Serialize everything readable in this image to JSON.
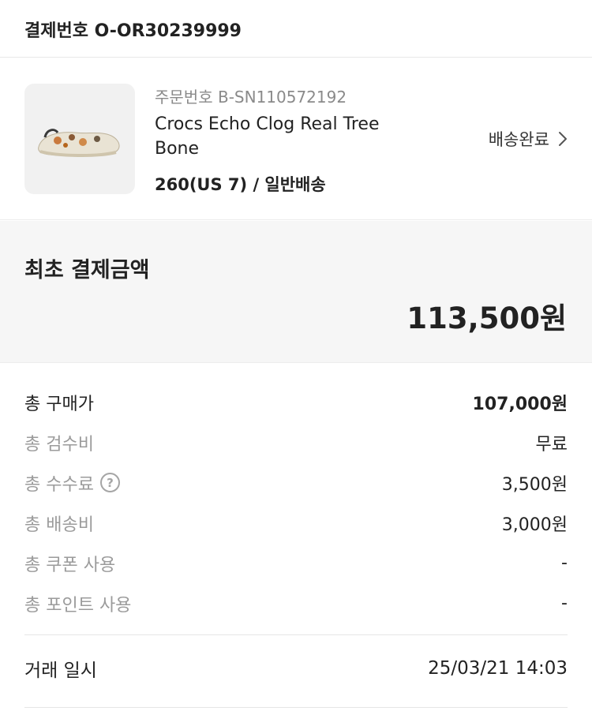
{
  "payment": {
    "label": "결제번호",
    "number": "O-OR30239999"
  },
  "product": {
    "order_label": "주문번호",
    "order_number": "B-SN110572192",
    "name": "Crocs Echo Clog Real Tree Bone",
    "option": "260(US 7) / 일반배송",
    "status": "배송완료",
    "thumbnail_icon": "clog-shoe-image"
  },
  "initial_payment": {
    "title": "최초 결제금액",
    "amount": "113,500원"
  },
  "breakdown": [
    {
      "label": "총 구매가",
      "value": "107,000원"
    },
    {
      "label": "총 검수비",
      "value": "무료"
    },
    {
      "label": "총 수수료",
      "value": "3,500원",
      "icon": "question-mark-circle-icon"
    },
    {
      "label": "총 배송비",
      "value": "3,000원"
    },
    {
      "label": "총 쿠폰 사용",
      "value": "-"
    },
    {
      "label": "총 포인트 사용",
      "value": "-"
    }
  ],
  "trade": {
    "label": "거래 일시",
    "datetime": "25/03/21 14:03"
  },
  "colors": {
    "text": "#222222",
    "muted": "#9b9b9b",
    "panel": "#f6f6f6",
    "divider": "#e6e6e6"
  }
}
